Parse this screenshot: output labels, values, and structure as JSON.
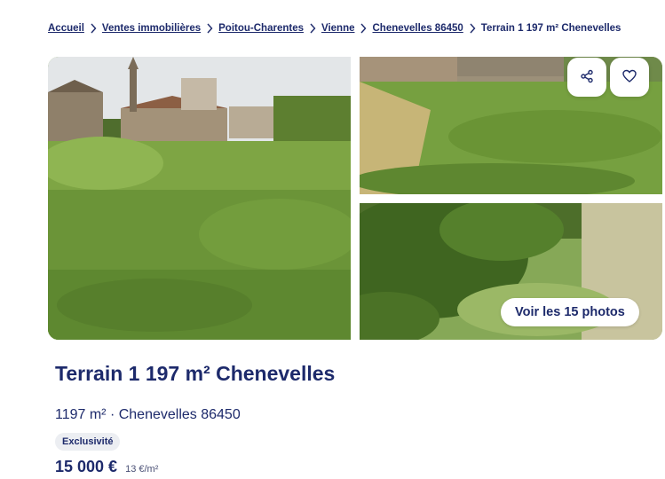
{
  "breadcrumb": {
    "items": [
      "Accueil",
      "Ventes immobilières",
      "Poitou-Charentes",
      "Vienne",
      "Chenevelles 86450"
    ],
    "current": "Terrain 1 197 m² Chenevelles"
  },
  "gallery": {
    "photos_button": "Voir les 15 photos",
    "share_icon": "share-icon",
    "favorite_icon": "heart-icon"
  },
  "listing": {
    "title": "Terrain 1 197 m² Chenevelles",
    "subtitle": "1197 m² · Chenevelles 86450",
    "badge": "Exclusivité",
    "price": "15 000 €",
    "price_per_sqm": "13 €/m²"
  },
  "colors": {
    "text_primary": "#1d2a6b",
    "badge_bg": "#eceef2",
    "background": "#ffffff"
  }
}
